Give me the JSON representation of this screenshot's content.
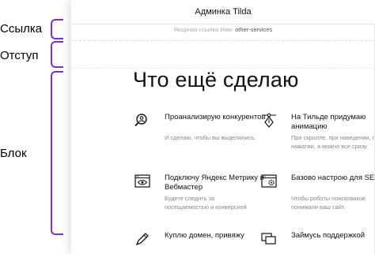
{
  "labels": {
    "link": "Ссылка",
    "indent": "Отступ",
    "block": "Блок"
  },
  "window": {
    "title": "Админка Tilda"
  },
  "anchor": {
    "prefix": "Якорная ссылка",
    "name_label": "Имя:",
    "name": "other-services"
  },
  "section": {
    "heading": "Что ещё сделаю"
  },
  "cards": [
    {
      "title": "Проанализирую конкурентов",
      "desc": "И сделаю, чтобы вы выделялись.",
      "icon": "magnifier-person-icon"
    },
    {
      "title": "На Тильде придумаю анимацию",
      "desc": "При скролле, при наведении, при нажатии, а можно все сразу.",
      "icon": "pen-tool-icon"
    },
    {
      "title": "Подключу Яндекс Метрику и Вебмастер",
      "desc": "Будете следить за посещаемостью и конверсией",
      "icon": "browser-eye-icon"
    },
    {
      "title": "Базово настрою для SEO",
      "desc": "Чтобы роботы поисковиков понимали ваш сайт.",
      "icon": "browser-gear-icon"
    },
    {
      "title": "Куплю домен, привяжу",
      "desc": "",
      "icon": "pencil-icon"
    },
    {
      "title": "Займусь поддержкой",
      "desc": "",
      "icon": "chat-icon"
    }
  ]
}
